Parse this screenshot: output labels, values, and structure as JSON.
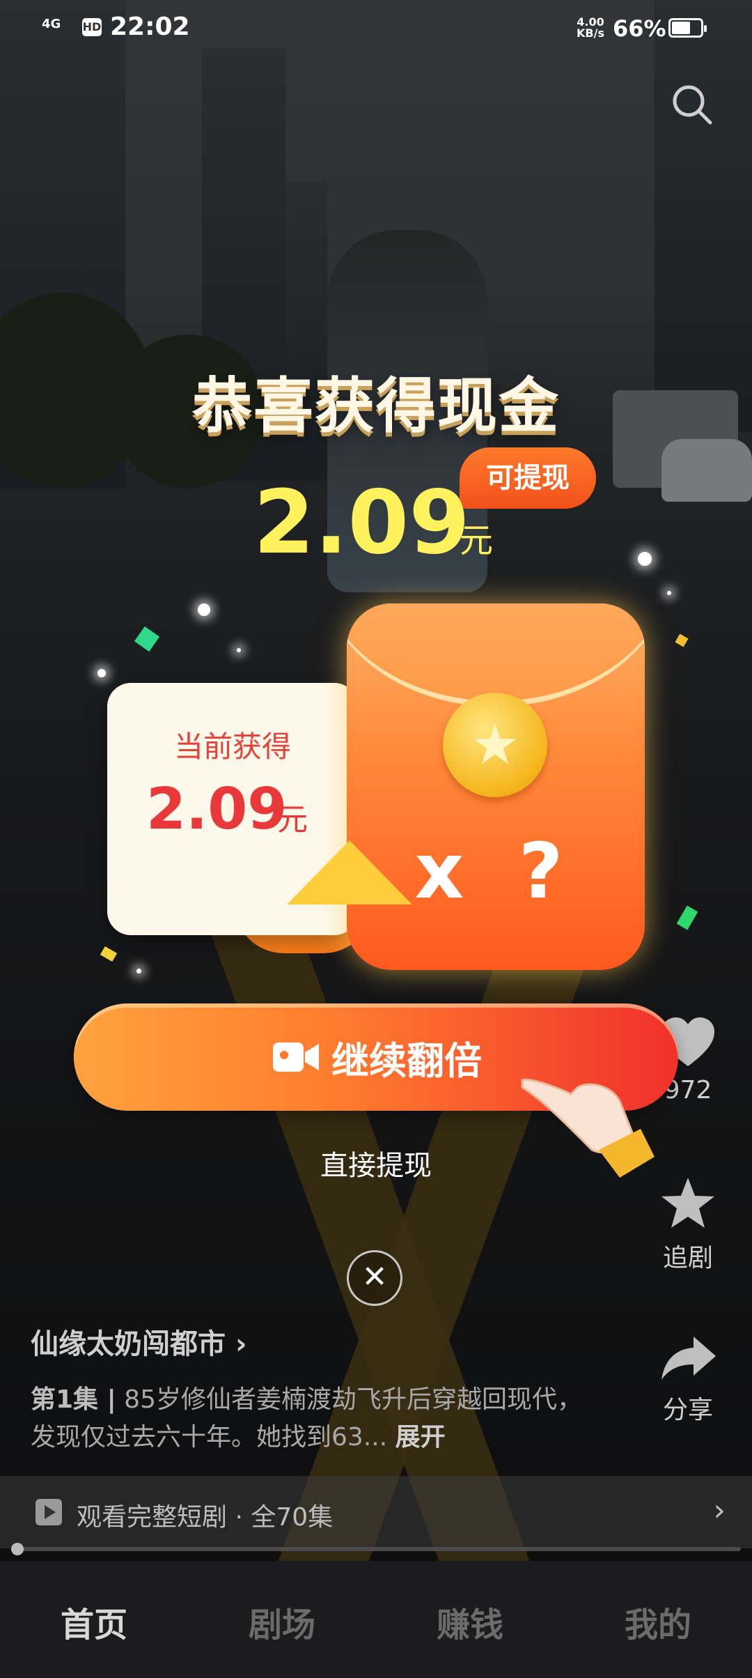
{
  "status_bar": {
    "network": "4G",
    "hd": "HD",
    "time": "22:02",
    "speed_value": "4.00",
    "speed_unit": "KB/s",
    "battery": "66%",
    "battery_level": 0.66
  },
  "rail": {
    "likes": "972",
    "follow_label": "追剧",
    "share_label": "分享"
  },
  "drama": {
    "title": "仙缘太奶闯都市",
    "chevron": "›",
    "episode": "第1集 |",
    "description": " 85岁修仙者姜楠渡劫飞升后穿越回现代，发现仅过去六十年。她找到63...",
    "expand": "展开",
    "full_series": "观看完整短剧 · 全70集",
    "full_series_chevron": "›"
  },
  "bottom_nav": {
    "items": [
      {
        "label": "首页",
        "active": true
      },
      {
        "label": "剧场",
        "active": false
      },
      {
        "label": "赚钱",
        "active": false
      },
      {
        "label": "我的",
        "active": false
      }
    ]
  },
  "reward_modal": {
    "title": "恭喜获得现金",
    "amount": "2.09",
    "unit": "元",
    "withdraw_badge": "可提现",
    "card_label": "当前获得",
    "card_amount": "2.09",
    "card_unit": "元",
    "multiplier": "x ?",
    "cta_label": "继续翻倍",
    "direct_withdraw": "直接提现",
    "close": "✕"
  },
  "colors": {
    "gold": "#fff25c",
    "cta_start": "#ffa23e",
    "cta_end": "#f0302c",
    "card_text": "#e8383a"
  },
  "icons": [
    "search-icon",
    "heart-icon",
    "star-icon",
    "share-icon",
    "play-icon",
    "video-camera-icon",
    "pointing-hand-icon",
    "close-icon",
    "coin-star-icon"
  ]
}
